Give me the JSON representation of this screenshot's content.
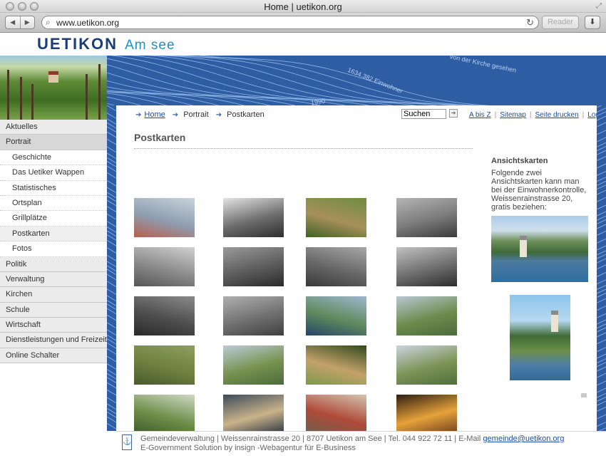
{
  "browser": {
    "window_title": "Home | uetikon.org",
    "url": "www.uetikon.org",
    "reader_label": "Reader"
  },
  "logo": {
    "word": "UETIKON",
    "suffix": "Am see"
  },
  "banner": {
    "texts": [
      "1634.382 Einwohner",
      "von der Kirche gesehen",
      "1990"
    ]
  },
  "sidenav": {
    "items": [
      {
        "label": "Aktuelles",
        "level": 0,
        "active": false
      },
      {
        "label": "Portrait",
        "level": 0,
        "active": true
      },
      {
        "label": "Geschichte",
        "level": 1,
        "active": false
      },
      {
        "label": "Das Uetiker Wappen",
        "level": 1,
        "active": false
      },
      {
        "label": "Statistisches",
        "level": 1,
        "active": false
      },
      {
        "label": "Ortsplan",
        "level": 1,
        "active": false
      },
      {
        "label": "Grillplätze",
        "level": 1,
        "active": false
      },
      {
        "label": "Postkarten",
        "level": 1,
        "active": true
      },
      {
        "label": "Fotos",
        "level": 1,
        "active": false
      },
      {
        "label": "Politik",
        "level": 0,
        "active": false
      },
      {
        "label": "Verwaltung",
        "level": 0,
        "active": false
      },
      {
        "label": "Kirchen",
        "level": 0,
        "active": false
      },
      {
        "label": "Schule",
        "level": 0,
        "active": false
      },
      {
        "label": "Wirtschaft",
        "level": 0,
        "active": false
      },
      {
        "label": "Dienstleistungen und Freizeit",
        "level": 0,
        "active": false
      },
      {
        "label": "Online Schalter",
        "level": 0,
        "active": false
      }
    ]
  },
  "breadcrumb": {
    "home": "Home",
    "portrait": "Portrait",
    "current": "Postkarten"
  },
  "search": {
    "value": "Suchen"
  },
  "toplinks": [
    "A bis Z",
    "Sitemap",
    "Seite drucken",
    "Login"
  ],
  "page": {
    "title": "Postkarten"
  },
  "postcards": [
    {
      "name": "postcard-1",
      "colors": [
        "#c9d3dc",
        "#8e9db0",
        "#b7604d"
      ],
      "bw": false
    },
    {
      "name": "postcard-2",
      "colors": [
        "#e4e4e4",
        "#6d6d6d",
        "#2e2e2e"
      ],
      "bw": true
    },
    {
      "name": "postcard-3",
      "colors": [
        "#6d8e3f",
        "#a88f5b",
        "#3d6325"
      ],
      "bw": false
    },
    {
      "name": "postcard-4",
      "colors": [
        "#b5b5b5",
        "#7a7a7a",
        "#3a3a3a"
      ],
      "bw": true
    },
    {
      "name": "postcard-5",
      "colors": [
        "#d1d1d1",
        "#8a8a8a",
        "#555555"
      ],
      "bw": true
    },
    {
      "name": "postcard-6",
      "colors": [
        "#9a9a9a",
        "#5c5c5c",
        "#2a2a2a"
      ],
      "bw": true
    },
    {
      "name": "postcard-7",
      "colors": [
        "#a7a7a7",
        "#666666",
        "#393939"
      ],
      "bw": true
    },
    {
      "name": "postcard-8",
      "colors": [
        "#c2c2c2",
        "#6f6f6f",
        "#2d2d2d"
      ],
      "bw": true
    },
    {
      "name": "postcard-9",
      "colors": [
        "#8a8a8a",
        "#4d4d4d",
        "#2a2a2a"
      ],
      "bw": true
    },
    {
      "name": "postcard-10",
      "colors": [
        "#b0b0b0",
        "#707070",
        "#3f3f3f"
      ],
      "bw": true
    },
    {
      "name": "postcard-11",
      "colors": [
        "#9fb7cf",
        "#5e8a5c",
        "#24456a"
      ],
      "bw": false
    },
    {
      "name": "postcard-12",
      "colors": [
        "#b9c7d2",
        "#6c8c4e",
        "#4c6b3a"
      ],
      "bw": false
    },
    {
      "name": "postcard-13",
      "colors": [
        "#8da05e",
        "#6e7f3f",
        "#4b5a2c"
      ],
      "bw": false
    },
    {
      "name": "postcard-14",
      "colors": [
        "#bccbd8",
        "#77924f",
        "#4a6c3c"
      ],
      "bw": false
    },
    {
      "name": "postcard-15",
      "colors": [
        "#2f4a1e",
        "#c4a16a",
        "#7a9a4a"
      ],
      "bw": false
    },
    {
      "name": "postcard-16",
      "colors": [
        "#c9d4df",
        "#7d9457",
        "#4f6f3c"
      ],
      "bw": false
    },
    {
      "name": "postcard-17",
      "colors": [
        "#cfd8c6",
        "#6f8f4a",
        "#3e5a2a"
      ],
      "bw": false
    },
    {
      "name": "postcard-18",
      "colors": [
        "#3c4a5a",
        "#c9b38a",
        "#2a3340"
      ],
      "bw": false
    },
    {
      "name": "postcard-19",
      "colors": [
        "#d4c4b0",
        "#b04a3a",
        "#6d5f4d"
      ],
      "bw": false
    },
    {
      "name": "postcard-20",
      "colors": [
        "#2d1e12",
        "#e6a23b",
        "#6e3f1c"
      ],
      "bw": false
    }
  ],
  "sidebar": {
    "heading": "Ansichtskarten",
    "text": "Folgende zwei Ansichtskarten kann man bei der Einwohnerkontrolle, Weissenrainstrasse 20, gratis beziehen:"
  },
  "footer": {
    "address": "Gemeindeverwaltung | Weissenrainstrasse 20 | 8707 Uetikon am See | Tel. 044 922 72 11 | E-Mail",
    "email": "gemeinde@uetikon.org",
    "credit": "E-Government Solution by insign -Webagentur für E-Business"
  }
}
